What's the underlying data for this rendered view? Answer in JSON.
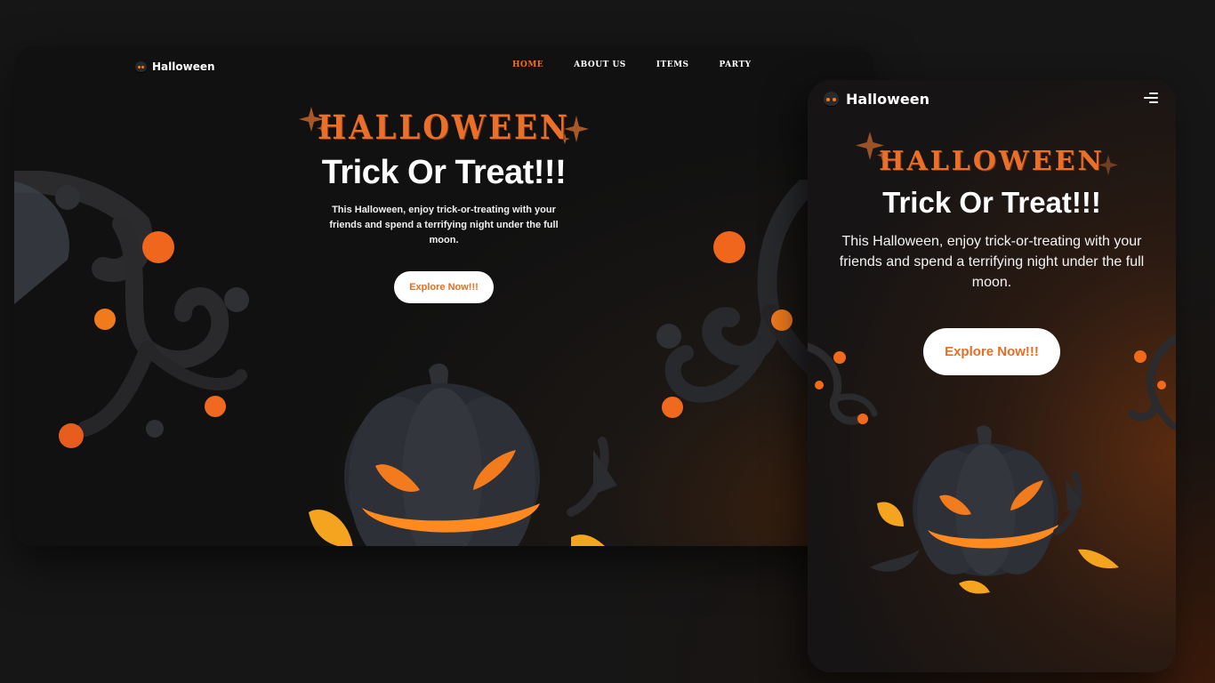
{
  "desktop": {
    "brand": "Halloween",
    "nav": [
      {
        "label": "Home",
        "active": true
      },
      {
        "label": "About Us",
        "active": false
      },
      {
        "label": "Items",
        "active": false
      },
      {
        "label": "Party",
        "active": false
      }
    ],
    "hero": {
      "heading": "HALLOWEEN",
      "title": "Trick Or Treat!!!",
      "description": "This Halloween, enjoy trick-or-treating with your friends and spend a terrifying night under the full moon.",
      "cta": "Explore Now!!!"
    }
  },
  "mobile": {
    "brand": "Halloween",
    "menu_icon": "hamburger-menu-icon",
    "hero": {
      "heading": "HALLOWEEN",
      "title": "Trick Or Treat!!!",
      "description": "This Halloween, enjoy trick-or-treating with your friends and spend a terrifying night under the full moon.",
      "cta": "Explore Now!!!"
    }
  },
  "colors": {
    "accent": "#f07326",
    "background": "#161616",
    "button_bg": "#ffffff",
    "button_text": "#e56e23",
    "text": "#ffffff"
  },
  "icons": [
    "skull-logo-icon",
    "star-icon",
    "hamburger-menu-icon",
    "pumpkin-illustration",
    "spooky-tree-illustration"
  ]
}
